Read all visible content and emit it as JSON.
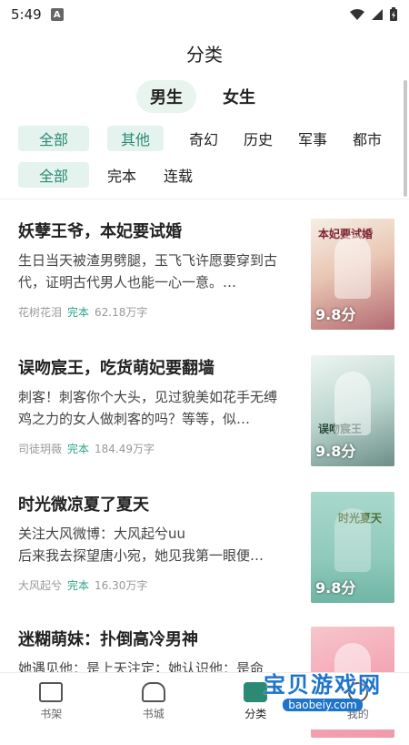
{
  "status_bar": {
    "time": "5:49",
    "notif_icon": "A"
  },
  "header": {
    "title": "分类"
  },
  "gender_tabs": [
    {
      "label": "男生",
      "active": true
    },
    {
      "label": "女生",
      "active": false
    }
  ],
  "genre_filters": [
    {
      "label": "全部",
      "active": true
    },
    {
      "label": "其他",
      "active": true
    },
    {
      "label": "奇幻",
      "active": false
    },
    {
      "label": "历史",
      "active": false
    },
    {
      "label": "军事",
      "active": false
    },
    {
      "label": "都市",
      "active": false
    }
  ],
  "status_filters": [
    {
      "label": "全部",
      "active": true
    },
    {
      "label": "完本",
      "active": false
    },
    {
      "label": "连载",
      "active": false
    }
  ],
  "books": [
    {
      "title": "妖孽王爷，本妃要试婚",
      "desc": "生日当天被渣男劈腿，玉飞飞许愿要穿到古代，证明古代男人也能一心一意。…",
      "author": "花树花泪",
      "status": "完本",
      "words": "62.18万字",
      "score": "9.8分",
      "cover_text": "本妃要试婚"
    },
    {
      "title": "误吻宸王，吃货萌妃要翻墙",
      "desc": "刺客！刺客你个大头，见过貌美如花手无缚鸡之力的女人做刺客的吗？等等，似…",
      "author": "司徒玥薇",
      "status": "完本",
      "words": "184.49万字",
      "score": "9.8分",
      "cover_text": "误吻宸王"
    },
    {
      "title": "时光微凉夏了夏天",
      "desc": "关注大风微博：大风起兮uu\n后来我去探望唐小宛，她见我第一眼便…",
      "author": "大风起兮",
      "status": "完本",
      "words": "16.30万字",
      "score": "9.8分",
      "cover_text": "时光夏天"
    },
    {
      "title": "迷糊萌妹：扑倒高冷男神",
      "desc": "她遇见他：是上天注定；她认识他：是命",
      "author": "",
      "status": "",
      "words": "",
      "score": "",
      "cover_text": ""
    }
  ],
  "tab_bar": [
    {
      "label": "书架",
      "icon": "bookshelf-icon",
      "active": false
    },
    {
      "label": "书城",
      "icon": "store-icon",
      "active": false
    },
    {
      "label": "分类",
      "icon": "category-icon",
      "active": true
    },
    {
      "label": "我的",
      "icon": "profile-icon",
      "active": false
    }
  ],
  "watermark": {
    "main": "宝贝游戏网",
    "sub": "baobeiy.com"
  },
  "colors": {
    "accent": "#2a8a74",
    "accent_bg": "#e4f3ee",
    "status_green": "#2aa38a"
  }
}
